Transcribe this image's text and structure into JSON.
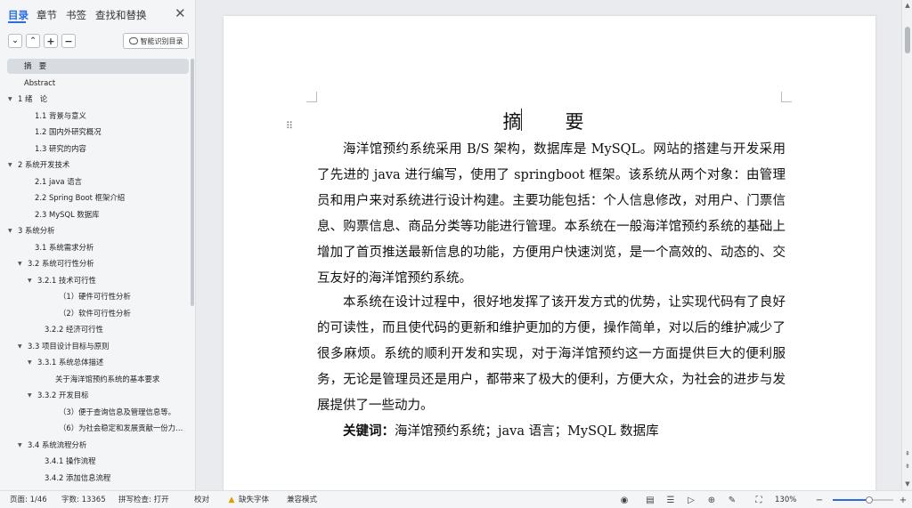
{
  "sidebar": {
    "tabs": [
      {
        "label": "目录",
        "active": true
      },
      {
        "label": "章节",
        "active": false
      },
      {
        "label": "书签",
        "active": false
      },
      {
        "label": "查找和替换",
        "active": false
      }
    ],
    "close_icon": "close-icon",
    "tools": {
      "collapse_icon": "chevron-down-icon",
      "expand_icon": "chevron-up-icon",
      "add_icon": "plus-icon",
      "remove_icon": "minus-icon",
      "smart_toc_label": "智能识别目录"
    },
    "toc": [
      {
        "text": "摘　要",
        "level": 0,
        "caret": false,
        "active": true
      },
      {
        "text": "Abstract",
        "level": 0,
        "caret": false
      },
      {
        "text": "1 绪　论",
        "level": 0,
        "caret": true
      },
      {
        "text": "1.1 背景与意义",
        "level": 1,
        "caret": false
      },
      {
        "text": "1.2  国内外研究概况",
        "level": 1,
        "caret": false
      },
      {
        "text": "1.3  研究的内容",
        "level": 1,
        "caret": false
      },
      {
        "text": "2  系统开发技术",
        "level": 0,
        "caret": true
      },
      {
        "text": "2.1 java 语言",
        "level": 1,
        "caret": false
      },
      {
        "text": "2.2 Spring Boot 框架介绍",
        "level": 1,
        "caret": false
      },
      {
        "text": "2.3 MySQL 数据库",
        "level": 1,
        "caret": false
      },
      {
        "text": "3 系统分析",
        "level": 0,
        "caret": true
      },
      {
        "text": "3.1  系统需求分析",
        "level": 1,
        "caret": false
      },
      {
        "text": "3.2  系统可行性分析",
        "level": 1,
        "caret": true
      },
      {
        "text": "3.2.1 技术可行性",
        "level": 2,
        "caret": true
      },
      {
        "text": "（1）硬件可行性分析",
        "level": 3,
        "caret": false
      },
      {
        "text": "（2）软件可行性分析",
        "level": 3,
        "caret": false
      },
      {
        "text": "3.2.2 经济可行性",
        "level": 2,
        "caret": false
      },
      {
        "text": "3.3  项目设计目标与原则",
        "level": 1,
        "caret": true
      },
      {
        "text": "3.3.1 系统总体描述",
        "level": 2,
        "caret": true
      },
      {
        "text": "关于海洋馆预约系统的基本要求",
        "level": 3,
        "caret": false,
        "indent_alt": true
      },
      {
        "text": "3.3.2 开发目标",
        "level": 2,
        "caret": true
      },
      {
        "text": "（3）便于查询信息及管理信息等。",
        "level": 3,
        "caret": false
      },
      {
        "text": "（6）为社会稳定和发展贡献一份力…",
        "level": 3,
        "caret": false
      },
      {
        "text": "3.4 系统流程分析",
        "level": 1,
        "caret": true
      },
      {
        "text": "3.4.1 操作流程",
        "level": 2,
        "caret": false
      },
      {
        "text": "3.4.2 添加信息流程",
        "level": 2,
        "caret": false
      }
    ]
  },
  "document": {
    "title": "摘　要",
    "paragraphs": [
      "海洋馆预约系统采用 B/S 架构，数据库是 MySQL。网站的搭建与开发采用了先进的 java 进行编写，使用了 springboot 框架。该系统从两个对象：由管理员和用户来对系统进行设计构建。主要功能包括：个人信息修改，对用户、门票信息、购票信息、商品分类等功能进行管理。本系统在一般海洋馆预约系统的基础上增加了首页推送最新信息的功能，方便用户快速浏览，是一个高效的、动态的、交互友好的海洋馆预约系统。",
      "本系统在设计过程中，很好地发挥了该开发方式的优势，让实现代码有了良好的可读性，而且使代码的更新和维护更加的方便，操作简单，对以后的维护减少了很多麻烦。系统的顺利开发和实现，对于海洋馆预约这一方面提供巨大的便利服务，无论是管理员还是用户，都带来了极大的便利，方便大众，为社会的进步与发展提供了一些动力。"
    ],
    "keywords_label": "关键词：",
    "keywords": "海洋馆预约系统；java 语言；MySQL 数据库"
  },
  "status_bar": {
    "page": "页面: 1/46",
    "word_count": "字数: 13365",
    "spellcheck": "拼写检查: 打开",
    "proofread": "校对",
    "missing_font": "缺失字体",
    "compat_mode": "兼容模式",
    "zoom": "130%",
    "zoom_fraction": 0.6,
    "icons": [
      "eye-icon",
      "page-view-icon",
      "list-icon",
      "outline-icon",
      "play-icon",
      "globe-icon",
      "pen-icon",
      "edit-icon",
      "fit-page-icon"
    ]
  },
  "colors": {
    "accent": "#2b6de0",
    "warning": "#e59a00"
  }
}
